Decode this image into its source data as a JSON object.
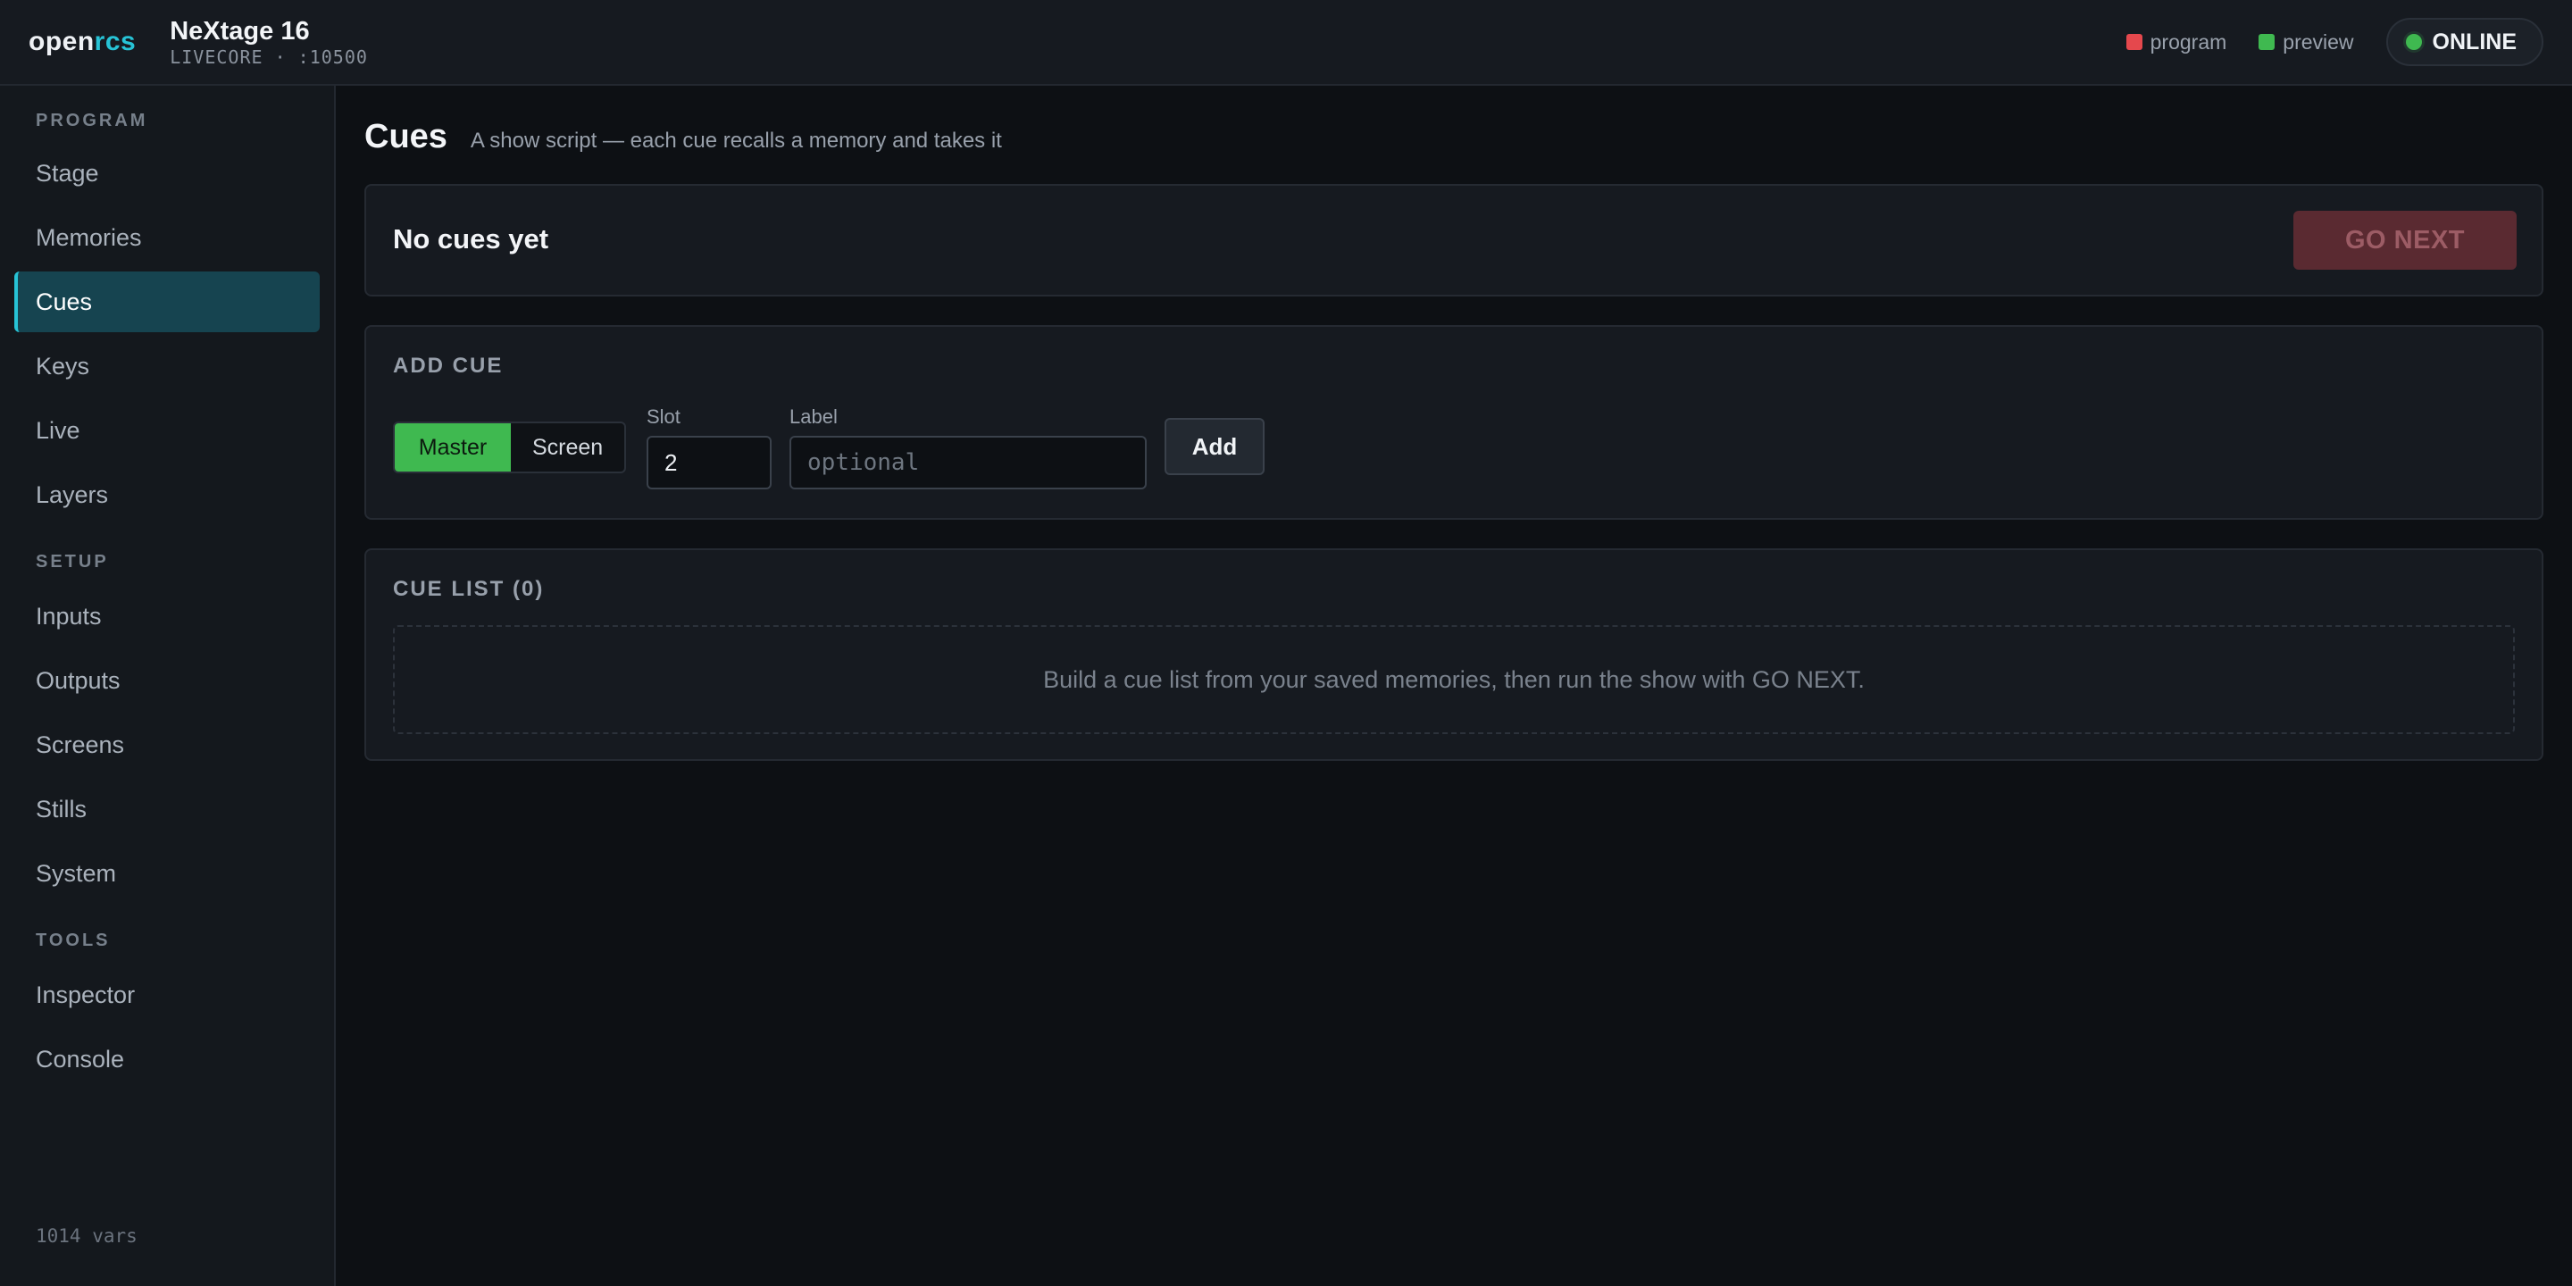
{
  "header": {
    "logo_main": "open",
    "logo_accent": "rcs",
    "device_name": "NeXtage 16",
    "device_sub": "LIVECORE · :10500",
    "legend": [
      {
        "label": "program",
        "color": "#e5484d"
      },
      {
        "label": "preview",
        "color": "#3fb950"
      }
    ],
    "status": "ONLINE"
  },
  "sidebar": {
    "sections": [
      {
        "title": "PROGRAM",
        "items": [
          "Stage",
          "Memories",
          "Cues",
          "Keys",
          "Live",
          "Layers"
        ]
      },
      {
        "title": "SETUP",
        "items": [
          "Inputs",
          "Outputs",
          "Screens",
          "Stills",
          "System"
        ]
      },
      {
        "title": "TOOLS",
        "items": [
          "Inspector",
          "Console"
        ]
      }
    ],
    "active": "Cues",
    "footer": "1014 vars"
  },
  "page": {
    "title": "Cues",
    "subtitle": "A show script — each cue recalls a memory and takes it"
  },
  "now_card": {
    "title": "No cues yet",
    "go_next": "GO NEXT"
  },
  "add_cue": {
    "heading": "ADD CUE",
    "target_options": [
      "Master",
      "Screen"
    ],
    "target_selected": "Master",
    "slot_label": "Slot",
    "slot_value": "2",
    "label_label": "Label",
    "label_placeholder": "optional",
    "add_button": "Add"
  },
  "cue_list": {
    "heading": "CUE LIST (0)",
    "empty_text": "Build a cue list from your saved memories, then run the show with GO NEXT."
  },
  "colors": {
    "accent": "#27c3d6",
    "active_bg": "#164450",
    "online": "#3fb950",
    "go_next_bg": "#5a2a31"
  }
}
